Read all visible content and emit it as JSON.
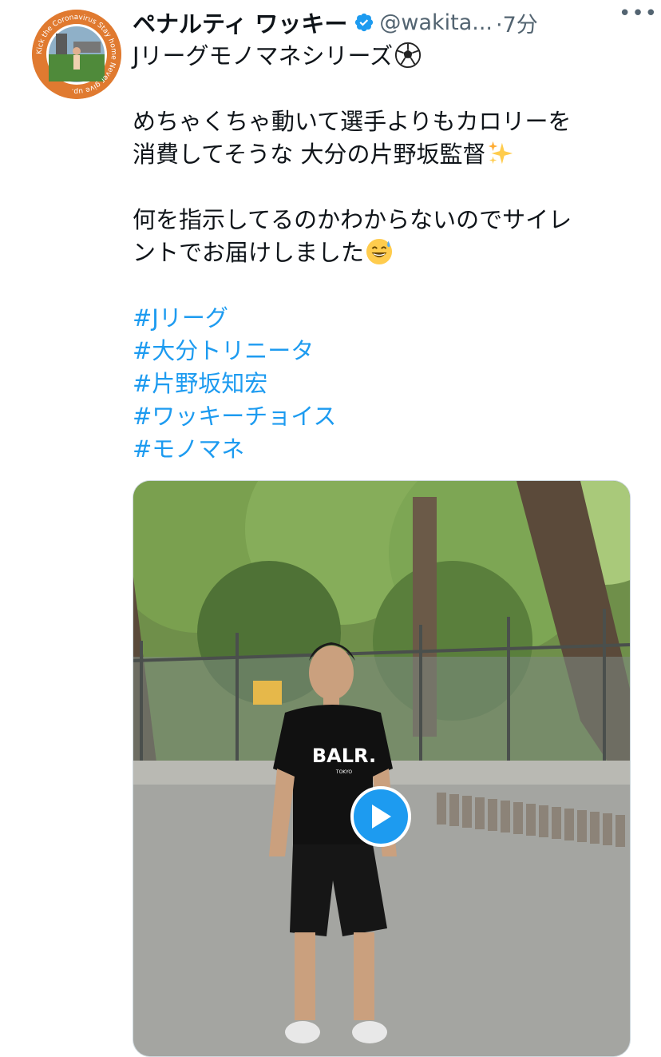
{
  "author": {
    "display_name": "ペナルティ ワッキー",
    "handle": "@wakita...",
    "timestamp": "·7分",
    "verified": true,
    "avatar_text": "Kick the Coronavirus Stay home Never give up."
  },
  "tweet": {
    "lines": [
      "Jリーグモノマネシリーズ",
      "",
      "めちゃくちゃ動いて選手よりもカロリーを",
      "消費してそうな 大分の片野坂監督",
      "",
      "何を指示してるのかわからないのでサイレ",
      "ントでお届けしました"
    ],
    "hashtags": [
      "#Jリーグ",
      "#大分トリニータ",
      "#片野坂知宏",
      "#ワッキーチョイス",
      "#モノマネ"
    ]
  },
  "media": {
    "type": "video",
    "shirt_text": "BALR.",
    "shirt_subtext": "TOKYO"
  },
  "colors": {
    "link": "#1d9bf0",
    "secondary_text": "#536471",
    "avatar_bg": "#e07a30"
  },
  "icons": [
    "verified-badge-icon",
    "more-icon",
    "soccer-ball-icon",
    "sparkles-icon",
    "sweat-smile-icon",
    "play-icon"
  ]
}
